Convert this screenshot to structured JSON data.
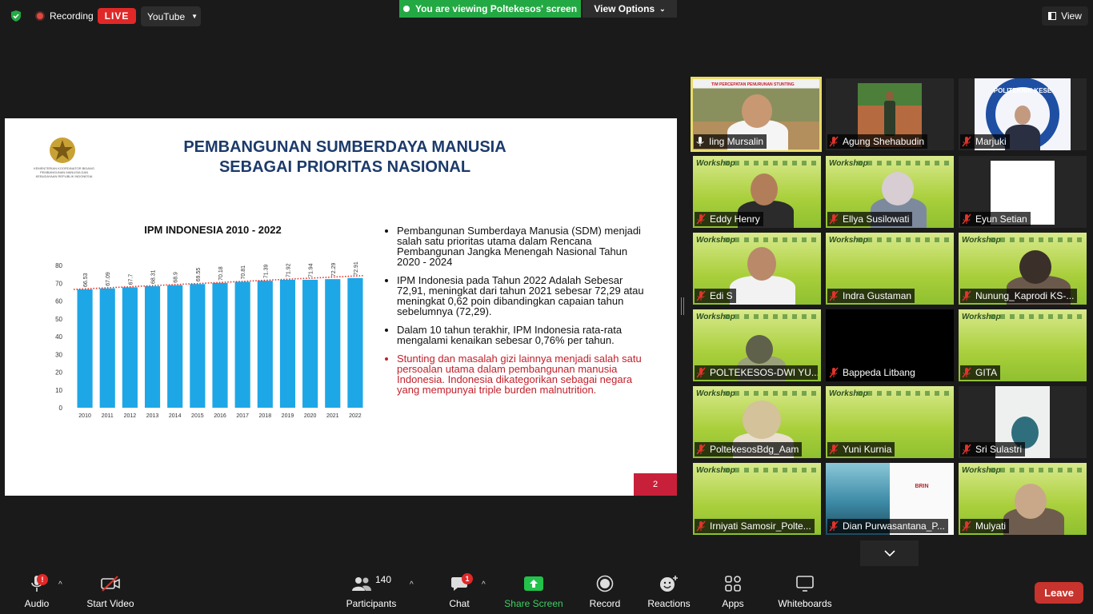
{
  "topbar": {
    "recording_label": "Recording",
    "live_badge": "LIVE",
    "stream_target": "YouTube",
    "viewing_banner": "You are viewing Poltekesos' screen",
    "view_options": "View Options",
    "view_button": "View"
  },
  "slide": {
    "ministry_text": "KEMENTERIAN KOORDINATOR BIDANG PEMBANGUNAN MANUSIA DAN KEBUDAYAAN REPUBLIK INDONESIA",
    "title_line1": "PEMBANGUNAN SUMBERDAYA MANUSIA",
    "title_line2": "SEBAGAI PRIORITAS NASIONAL",
    "page_number": "2",
    "bullets": [
      "Pembangunan Sumberdaya Manusia (SDM) menjadi salah satu prioritas utama dalam Rencana Pembangunan Jangka Menengah Nasional Tahun 2020 - 2024",
      "IPM Indonesia pada Tahun 2022 Adalah Sebesar 72,91, meningkat dari  tahun 2021 sebesar 72,29 atau meningkat 0,62 poin dibandingkan capaian tahun sebelumnya (72,29).",
      "Dalam 10 tahun terakhir, IPM Indonesia rata-rata mengalami kenaikan sebesar 0,76% per tahun.",
      "Stunting dan masalah gizi lainnya menjadi salah satu persoalan utama dalam pembangunan manusia Indonesia.  Indonesia dikategorikan sebagai negara yang mempunyai triple burden malnutrition."
    ]
  },
  "chart_data": {
    "type": "bar",
    "title": "IPM INDONESIA 2010 - 2022",
    "categories": [
      "2010",
      "2011",
      "2012",
      "2013",
      "2014",
      "2015",
      "2016",
      "2017",
      "2018",
      "2019",
      "2020",
      "2021",
      "2022"
    ],
    "values": [
      66.53,
      67.09,
      67.7,
      68.31,
      68.9,
      69.55,
      70.18,
      70.81,
      71.39,
      71.92,
      71.94,
      72.29,
      72.91
    ],
    "ylim": [
      0,
      80
    ],
    "yticks": [
      0,
      10,
      20,
      30,
      40,
      50,
      60,
      70,
      80
    ],
    "bar_color": "#1ea7e6",
    "trend_color": "#e0342b",
    "xlabel": "",
    "ylabel": ""
  },
  "participants_tiles": [
    {
      "name": "Iing Mursalin",
      "bg": "photo",
      "muted": false,
      "header": "TIM PERCEPATAN PENURUNAN STUNTING"
    },
    {
      "name": "Agung Shehabudin",
      "bg": "dark",
      "muted": true
    },
    {
      "name": "Marjuki",
      "bg": "dark",
      "muted": true,
      "logo_text": "POLITEKNIK KESE"
    },
    {
      "name": "Eddy Henry",
      "bg": "green",
      "muted": true,
      "logo": "Workshop"
    },
    {
      "name": "Ellya Susilowati",
      "bg": "green",
      "muted": true,
      "logo": "Workshop"
    },
    {
      "name": "Eyun Setian",
      "bg": "dark",
      "muted": true
    },
    {
      "name": "Edi S",
      "bg": "green",
      "muted": true,
      "logo": "Workshop"
    },
    {
      "name": "Indra Gustaman",
      "bg": "green",
      "muted": true,
      "logo": "Workshop"
    },
    {
      "name": "Nunung_Kaprodi KS-...",
      "bg": "green",
      "muted": true,
      "logo": "Workshop"
    },
    {
      "name": "POLTEKESOS-DWI YU...",
      "bg": "green",
      "muted": true,
      "logo": "Workshop"
    },
    {
      "name": "Bappeda Litbang",
      "bg": "black",
      "muted": true
    },
    {
      "name": "GITA",
      "bg": "green",
      "muted": true,
      "logo": "Workshop"
    },
    {
      "name": "PoltekesosBdg_Aam",
      "bg": "green",
      "muted": true,
      "logo": "Workshop"
    },
    {
      "name": "Yuni Kurnia",
      "bg": "green",
      "muted": true,
      "logo": "Workshop"
    },
    {
      "name": "Sri Sulastri",
      "bg": "dark",
      "muted": true
    },
    {
      "name": "Irniyati Samosir_Polte...",
      "bg": "green",
      "muted": true,
      "logo": "Workshop"
    },
    {
      "name": "Dian Purwasantana_P...",
      "bg": "photo2",
      "muted": true,
      "logo": "BRIN"
    },
    {
      "name": "Mulyati",
      "bg": "green",
      "muted": true,
      "logo": "Workshop"
    }
  ],
  "toolbar": {
    "audio": "Audio",
    "start_video": "Start Video",
    "participants": "Participants",
    "participants_count": "140",
    "chat": "Chat",
    "chat_badge": "1",
    "audio_badge": "!",
    "share_screen": "Share Screen",
    "record": "Record",
    "reactions": "Reactions",
    "apps": "Apps",
    "whiteboards": "Whiteboards",
    "leave": "Leave"
  },
  "colors": {
    "accent_green": "#23a943",
    "live_red": "#e02828",
    "leave_red": "#c6342d",
    "active_speaker": "#e8dc6a"
  }
}
